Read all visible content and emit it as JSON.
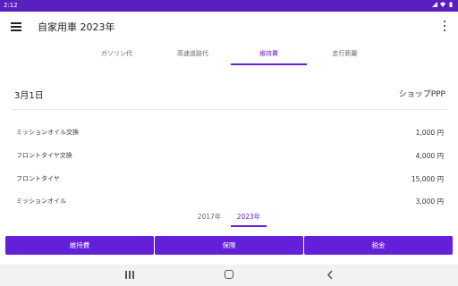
{
  "status": {
    "time": "2:12"
  },
  "appbar": {
    "title": "自家用車 2023年"
  },
  "tabs": [
    {
      "label": "ガソリン代",
      "active": false
    },
    {
      "label": "高速道路代",
      "active": false
    },
    {
      "label": "維持費",
      "active": true
    },
    {
      "label": "走行距離",
      "active": false
    }
  ],
  "entry": {
    "date": "3月1日",
    "shop": "ショップPPP"
  },
  "items": [
    {
      "label": "ミッションオイル交換",
      "amount": "1,000 円"
    },
    {
      "label": "フロントタイヤ交換",
      "amount": "4,000 円"
    },
    {
      "label": "フロントタイヤ",
      "amount": "15,000 円"
    },
    {
      "label": "ミッションオイル",
      "amount": "3,000 円"
    }
  ],
  "years": [
    {
      "label": "2017年",
      "active": false
    },
    {
      "label": "2023年",
      "active": true
    }
  ],
  "buttons": {
    "maintenance": "維持費",
    "insurance": "保険",
    "tax": "税金"
  },
  "colors": {
    "accent": "#6a1fd0",
    "button": "#6320d8",
    "statusbar": "#5a1fbf"
  },
  "icons": [
    "menu-icon",
    "more-vert-icon",
    "wifi-icon",
    "battery-icon",
    "recent-apps-icon",
    "home-icon",
    "back-icon"
  ]
}
